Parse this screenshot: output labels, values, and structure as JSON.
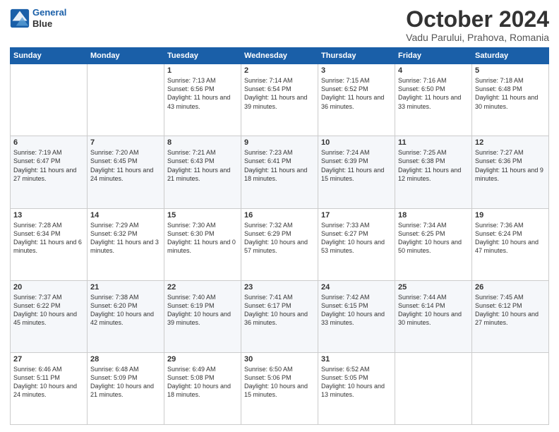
{
  "header": {
    "logo_line1": "General",
    "logo_line2": "Blue",
    "title": "October 2024",
    "subtitle": "Vadu Parului, Prahova, Romania"
  },
  "days_of_week": [
    "Sunday",
    "Monday",
    "Tuesday",
    "Wednesday",
    "Thursday",
    "Friday",
    "Saturday"
  ],
  "weeks": [
    [
      {
        "day": "",
        "content": ""
      },
      {
        "day": "",
        "content": ""
      },
      {
        "day": "1",
        "content": "Sunrise: 7:13 AM\nSunset: 6:56 PM\nDaylight: 11 hours and 43 minutes."
      },
      {
        "day": "2",
        "content": "Sunrise: 7:14 AM\nSunset: 6:54 PM\nDaylight: 11 hours and 39 minutes."
      },
      {
        "day": "3",
        "content": "Sunrise: 7:15 AM\nSunset: 6:52 PM\nDaylight: 11 hours and 36 minutes."
      },
      {
        "day": "4",
        "content": "Sunrise: 7:16 AM\nSunset: 6:50 PM\nDaylight: 11 hours and 33 minutes."
      },
      {
        "day": "5",
        "content": "Sunrise: 7:18 AM\nSunset: 6:48 PM\nDaylight: 11 hours and 30 minutes."
      }
    ],
    [
      {
        "day": "6",
        "content": "Sunrise: 7:19 AM\nSunset: 6:47 PM\nDaylight: 11 hours and 27 minutes."
      },
      {
        "day": "7",
        "content": "Sunrise: 7:20 AM\nSunset: 6:45 PM\nDaylight: 11 hours and 24 minutes."
      },
      {
        "day": "8",
        "content": "Sunrise: 7:21 AM\nSunset: 6:43 PM\nDaylight: 11 hours and 21 minutes."
      },
      {
        "day": "9",
        "content": "Sunrise: 7:23 AM\nSunset: 6:41 PM\nDaylight: 11 hours and 18 minutes."
      },
      {
        "day": "10",
        "content": "Sunrise: 7:24 AM\nSunset: 6:39 PM\nDaylight: 11 hours and 15 minutes."
      },
      {
        "day": "11",
        "content": "Sunrise: 7:25 AM\nSunset: 6:38 PM\nDaylight: 11 hours and 12 minutes."
      },
      {
        "day": "12",
        "content": "Sunrise: 7:27 AM\nSunset: 6:36 PM\nDaylight: 11 hours and 9 minutes."
      }
    ],
    [
      {
        "day": "13",
        "content": "Sunrise: 7:28 AM\nSunset: 6:34 PM\nDaylight: 11 hours and 6 minutes."
      },
      {
        "day": "14",
        "content": "Sunrise: 7:29 AM\nSunset: 6:32 PM\nDaylight: 11 hours and 3 minutes."
      },
      {
        "day": "15",
        "content": "Sunrise: 7:30 AM\nSunset: 6:30 PM\nDaylight: 11 hours and 0 minutes."
      },
      {
        "day": "16",
        "content": "Sunrise: 7:32 AM\nSunset: 6:29 PM\nDaylight: 10 hours and 57 minutes."
      },
      {
        "day": "17",
        "content": "Sunrise: 7:33 AM\nSunset: 6:27 PM\nDaylight: 10 hours and 53 minutes."
      },
      {
        "day": "18",
        "content": "Sunrise: 7:34 AM\nSunset: 6:25 PM\nDaylight: 10 hours and 50 minutes."
      },
      {
        "day": "19",
        "content": "Sunrise: 7:36 AM\nSunset: 6:24 PM\nDaylight: 10 hours and 47 minutes."
      }
    ],
    [
      {
        "day": "20",
        "content": "Sunrise: 7:37 AM\nSunset: 6:22 PM\nDaylight: 10 hours and 45 minutes."
      },
      {
        "day": "21",
        "content": "Sunrise: 7:38 AM\nSunset: 6:20 PM\nDaylight: 10 hours and 42 minutes."
      },
      {
        "day": "22",
        "content": "Sunrise: 7:40 AM\nSunset: 6:19 PM\nDaylight: 10 hours and 39 minutes."
      },
      {
        "day": "23",
        "content": "Sunrise: 7:41 AM\nSunset: 6:17 PM\nDaylight: 10 hours and 36 minutes."
      },
      {
        "day": "24",
        "content": "Sunrise: 7:42 AM\nSunset: 6:15 PM\nDaylight: 10 hours and 33 minutes."
      },
      {
        "day": "25",
        "content": "Sunrise: 7:44 AM\nSunset: 6:14 PM\nDaylight: 10 hours and 30 minutes."
      },
      {
        "day": "26",
        "content": "Sunrise: 7:45 AM\nSunset: 6:12 PM\nDaylight: 10 hours and 27 minutes."
      }
    ],
    [
      {
        "day": "27",
        "content": "Sunrise: 6:46 AM\nSunset: 5:11 PM\nDaylight: 10 hours and 24 minutes."
      },
      {
        "day": "28",
        "content": "Sunrise: 6:48 AM\nSunset: 5:09 PM\nDaylight: 10 hours and 21 minutes."
      },
      {
        "day": "29",
        "content": "Sunrise: 6:49 AM\nSunset: 5:08 PM\nDaylight: 10 hours and 18 minutes."
      },
      {
        "day": "30",
        "content": "Sunrise: 6:50 AM\nSunset: 5:06 PM\nDaylight: 10 hours and 15 minutes."
      },
      {
        "day": "31",
        "content": "Sunrise: 6:52 AM\nSunset: 5:05 PM\nDaylight: 10 hours and 13 minutes."
      },
      {
        "day": "",
        "content": ""
      },
      {
        "day": "",
        "content": ""
      }
    ]
  ]
}
